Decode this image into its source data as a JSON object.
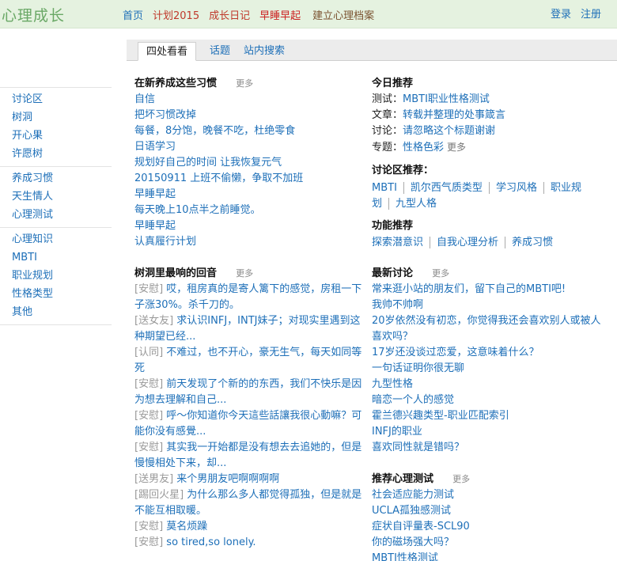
{
  "header": {
    "logo": "心理成长",
    "nav": [
      "首页",
      "计划2015",
      "成长日记",
      "早睡早起",
      "建立心理档案"
    ],
    "login": "登录",
    "register": "注册"
  },
  "tabs": [
    "四处看看",
    "话题",
    "站内搜索"
  ],
  "sidebar": {
    "groups": [
      [
        "讨论区",
        "树洞",
        "开心果",
        "许愿树"
      ],
      [
        "养成习惯",
        "天生情人",
        "心理测试"
      ],
      [
        "心理知识",
        "MBTI",
        "职业规划",
        "性格类型",
        "其他"
      ]
    ]
  },
  "habits": {
    "title": "在新养成这些习惯",
    "more": "更多",
    "items": [
      "自信",
      "把坏习惯改掉",
      "每餐，8分饱，晚餐不吃，杜绝零食",
      "日语学习",
      "规划好自己的时间 让我恢复元气",
      "20150911 上班不偷懒，争取不加班",
      "早睡早起",
      "每天晚上10点半之前睡觉。",
      "早睡早起",
      "认真履行计划"
    ]
  },
  "replies": {
    "title": "树洞里最响的回音",
    "more": "更多",
    "items": [
      {
        "tag": "[安慰]",
        "text": "哎，租房真的是寄人篱下的感觉，房租一下子涨30%。杀千刀的。"
      },
      {
        "tag": "[送女友]",
        "text": "求认识INFJ，INTJ妹子；对现实里遇到这种期望已经..."
      },
      {
        "tag": "[认同]",
        "text": "不难过，也不开心，豪无生气，每天如同等死"
      },
      {
        "tag": "[安慰]",
        "text": "前天发现了个新的的东西，我们不快乐是因为想去理解和自己..."
      },
      {
        "tag": "[安慰]",
        "text": "呼～你知道你今天這些話讓我很心動嘛？可能你没有感覺..."
      },
      {
        "tag": "[安慰]",
        "text": "其实我一开始都是没有想去去追她的，但是慢慢相处下来，却..."
      },
      {
        "tag": "[送男友]",
        "text": "来个男朋友吧啊啊啊啊"
      },
      {
        "tag": "[踢回火星]",
        "text": "为什么那么多人都觉得孤独，但是就是不能互相取暖。"
      },
      {
        "tag": "[安慰]",
        "text": "莫名烦躁"
      },
      {
        "tag": "[安慰]",
        "text": "so tired,so lonely."
      }
    ]
  },
  "today": {
    "title": "今日推荐",
    "rows": [
      {
        "label": "测试：",
        "value": "MBTI职业性格测试"
      },
      {
        "label": "文章：",
        "value": "转载并整理的处事箴言"
      },
      {
        "label": "讨论：",
        "value": "请忽略这个标题谢谢"
      },
      {
        "label": "专题：",
        "value": "性格色彩",
        "more": "更多"
      }
    ]
  },
  "forum": {
    "title": "讨论区推荐：",
    "items": [
      "MBTI",
      "凯尔西气质类型",
      "学习风格",
      "职业规划",
      "九型人格"
    ]
  },
  "features": {
    "title": "功能推荐",
    "items": [
      "探索潜意识",
      "自我心理分析",
      "养成习惯"
    ]
  },
  "discussions": {
    "title": "最新讨论",
    "more": "更多",
    "items": [
      "常来逛小站的朋友们，留下自己的MBTI吧!",
      "我帅不帅啊",
      "20岁依然没有初恋，你觉得我还会喜欢别人或被人喜欢吗？",
      "17岁还没谈过恋爱，这意味着什么？",
      "一句话证明你很无聊",
      "九型性格",
      "暗恋一个人的感觉",
      "霍兰德兴趣类型-职业匹配索引",
      "INFJ的职业",
      "喜欢同性就是错吗？"
    ]
  },
  "tests": {
    "title": "推荐心理测试",
    "more": "更多",
    "items": [
      "社会适应能力测试",
      "UCLA孤独感测试",
      "症状自评量表-SCL90",
      "你的磁场强大吗？",
      "MBTI性格测试"
    ]
  }
}
